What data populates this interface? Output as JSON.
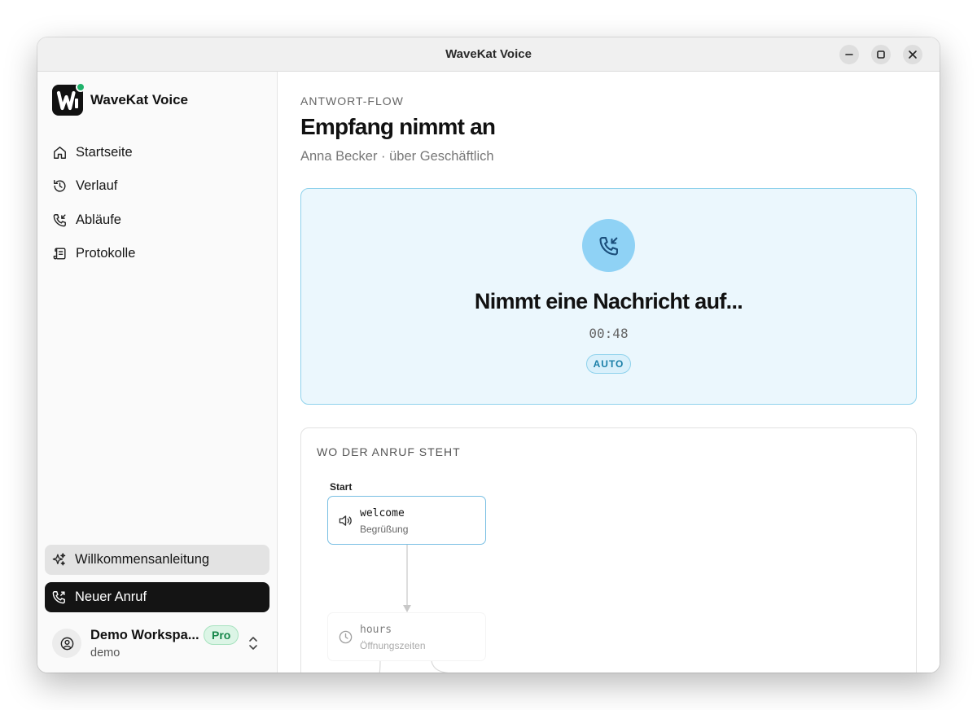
{
  "window": {
    "title": "WaveKat Voice"
  },
  "sidebar": {
    "brand": "WaveKat Voice",
    "logo_letter": "W",
    "items": [
      {
        "label": "Startseite",
        "icon": "home-icon"
      },
      {
        "label": "Verlauf",
        "icon": "history-icon"
      },
      {
        "label": "Abläufe",
        "icon": "phone-flow-icon"
      },
      {
        "label": "Protokolle",
        "icon": "scroll-icon"
      }
    ],
    "welcome_label": "Willkommensanleitung",
    "new_call_label": "Neuer Anruf",
    "workspace": {
      "name": "Demo Workspa...",
      "slug": "demo",
      "badge": "Pro"
    }
  },
  "main": {
    "eyebrow": "ANTWORT-FLOW",
    "title": "Empfang nimmt an",
    "subtitle": "Anna Becker · über Geschäftlich",
    "status": {
      "title": "Nimmt eine Nachricht auf...",
      "timer": "00:48",
      "badge": "AUTO"
    },
    "flow": {
      "heading": "WO DER ANRUF STEHT",
      "start_label": "Start",
      "nodes": [
        {
          "id": "welcome",
          "label": "Begrüßung",
          "icon": "speaker-icon",
          "state": "active"
        },
        {
          "id": "hours",
          "label": "Öffnungszeiten",
          "icon": "clock-icon",
          "state": "inactive"
        }
      ]
    }
  },
  "colors": {
    "accent": "#8fd2f5",
    "status_bg": "#ebf7fd",
    "status_border": "#8fd2ec",
    "online_dot": "#1fb26b",
    "pro_badge": "#16874a",
    "primary_button": "#141414"
  }
}
